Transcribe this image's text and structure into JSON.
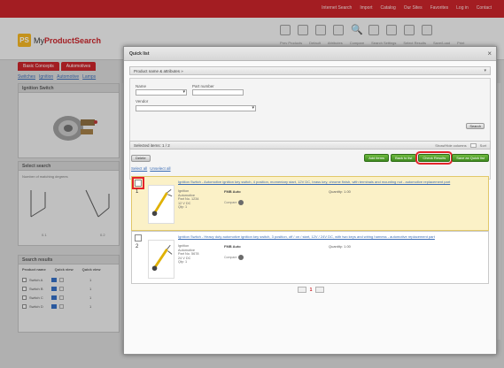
{
  "topbar": {
    "links": [
      "Internet Search",
      "Import",
      "Catalog",
      "Our Sites",
      "Favorites",
      "Log in",
      "Contact"
    ]
  },
  "brand": {
    "badge": "PS",
    "name_my": "My",
    "name_rest": "ProductSearch"
  },
  "toolbar": {
    "icons": [
      "document-icon",
      "columns-icon",
      "list-icon",
      "image-icon",
      "search-icon",
      "undo-icon",
      "redo-icon",
      "print-icon",
      "export-icon"
    ],
    "labels": [
      "Prev Products",
      "Default",
      "Attributes",
      "Compare",
      "Search Settings",
      "Select Results",
      "Save/Load",
      "Print"
    ]
  },
  "tabs": [
    "Basic Concepts",
    "Automotives"
  ],
  "breadcrumb": [
    "Switches",
    "Ignition",
    "Automotive",
    "Lamps"
  ],
  "left_panels": {
    "image_title": "Ignition Switch",
    "sketch_title": "Select search",
    "sketch_text": "Number of matching degrees",
    "sketch_labels": [
      "0.1",
      "0.2"
    ],
    "search_title": "Search results",
    "search_head": [
      "Product name",
      "Quick view",
      "Quick view"
    ],
    "search_rows": [
      {
        "label": "Switch A",
        "value": "1"
      },
      {
        "label": "Switch B",
        "value": "1"
      },
      {
        "label": "Switch C",
        "value": "1"
      },
      {
        "label": "Switch D",
        "value": "1"
      }
    ]
  },
  "modal": {
    "title": "Quick list",
    "close": "×",
    "select_bar": "Product name & attributes »",
    "filters": {
      "name_label": "Name",
      "partno_label": "Part number",
      "vendor_label": "Vendor",
      "name_value": "",
      "partno_value": "",
      "vendor_value": "",
      "search_button": "Search"
    },
    "results_bar": "Selected items: 1 / 2",
    "results_right": [
      "Show/Hide columns",
      "Sort"
    ],
    "delete_button": "Delete",
    "green_buttons": [
      "Add items",
      "Back to list",
      "Check Results",
      "Save as Quick list"
    ],
    "highlighted_button_index": 2,
    "select_links": [
      "Select all",
      "Unselect all"
    ],
    "cards": [
      {
        "index": "1",
        "title": "Ignition Switch - Automotive ignition key switch, 4 position, momentary start, 12V DC, brass key, chrome finish, with terminals and mounting nut - automotive replacement part",
        "meta": [
          "Ignition",
          "Automotive",
          "Part No. 1234",
          "12 V DC",
          "Qty: 1"
        ],
        "brand": "FMB Auto",
        "flag": "Compare",
        "qty": "Quantity: 1.00",
        "selected": true
      },
      {
        "index": "2",
        "title": "Ignition Switch - Heavy duty automotive ignition key switch, 3 position, off / on / start, 12V / 24V DC, with two keys and wiring harness - automotive replacement part",
        "meta": [
          "Ignition",
          "Automotive",
          "Part No. 5678",
          "24 V DC",
          "Qty: 1"
        ],
        "brand": "FMB Auto",
        "flag": "Compare",
        "qty": "Quantity: 1.00",
        "selected": false
      }
    ],
    "pager": {
      "current": "1"
    }
  }
}
